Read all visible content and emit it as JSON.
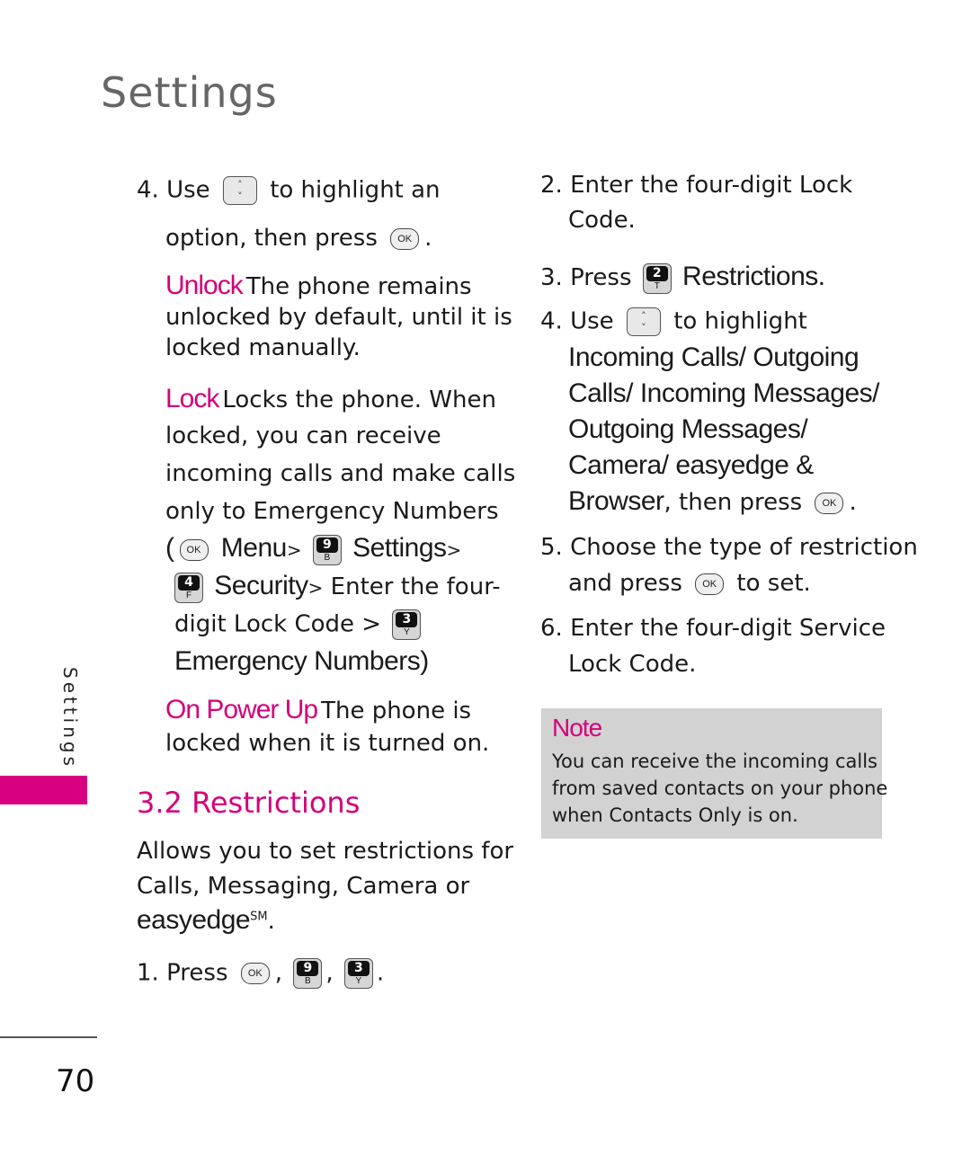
{
  "header": {
    "title": "Settings"
  },
  "side_tab": {
    "label": "Settings"
  },
  "page_number": "70",
  "left_column": {
    "step4": {
      "number": "4.",
      "use": "Use",
      "text1": "to highlight an",
      "text2": "option, then press",
      "period": "."
    },
    "unlock": {
      "term": "Unlock",
      "lines": [
        "The phone remains",
        "unlocked by default, until it is",
        "locked manually."
      ]
    },
    "lock": {
      "term": "Lock",
      "lines": [
        "Locks the phone. When",
        "locked, you can receive",
        "incoming calls and make calls",
        "only to Emergency Numbers"
      ],
      "path": {
        "open_paren": "(",
        "menu": "Menu",
        "sep": ">",
        "settings": "Settings",
        "security": "Security",
        "enter": "Enter the four-",
        "digit": "digit Lock Code >",
        "emergency": "Emergency Numbers",
        "close_paren": ")"
      }
    },
    "power_up": {
      "term": "On Power Up",
      "lines": [
        "The phone is",
        "locked when it is turned on."
      ]
    },
    "section": {
      "heading": "3.2 Restrictions",
      "desc_lines": [
        "Allows you to set restrictions for",
        "Calls, Messaging, Camera or"
      ],
      "easyedge": "easyedge",
      "sm": "SM",
      "period": "."
    },
    "step1": {
      "number": "1.",
      "text": "Press",
      "comma": ",",
      "period": "."
    }
  },
  "right_column": {
    "step2": {
      "number": "2.",
      "lines": [
        "Enter the four-digit Lock",
        "Code."
      ]
    },
    "step3": {
      "number": "3.",
      "text": "Press",
      "target": "Restrictions."
    },
    "step4": {
      "number": "4.",
      "use": "Use",
      "text": "to highlight",
      "options": [
        "Incoming Calls/ Outgoing",
        "Calls/ Incoming Messages/",
        "Outgoing Messages/",
        "Camera/ easyedge &"
      ],
      "last_option": "Browser",
      "then_press": ", then press",
      "period": "."
    },
    "step5": {
      "number": "5.",
      "line1": "Choose the type of restriction",
      "line2a": "and press",
      "line2b": "to set."
    },
    "step6": {
      "number": "6.",
      "lines": [
        "Enter the four-digit Service",
        "Lock Code."
      ]
    },
    "note": {
      "title": "Note",
      "lines": [
        "You can receive the incoming calls",
        "from saved contacts on your phone",
        "when Contacts Only is on."
      ]
    }
  },
  "keys": {
    "ok": "OK",
    "k9": {
      "digit": "9",
      "letter": "B"
    },
    "k4": {
      "digit": "4",
      "letter": "F"
    },
    "k3": {
      "digit": "3",
      "letter": "Y"
    },
    "k2": {
      "digit": "2",
      "letter": "T"
    }
  },
  "colors": {
    "accent": "#d4007a",
    "side_tab": "#d8007f",
    "note_bg": "#d2d2d2",
    "title_gray": "#666666"
  }
}
